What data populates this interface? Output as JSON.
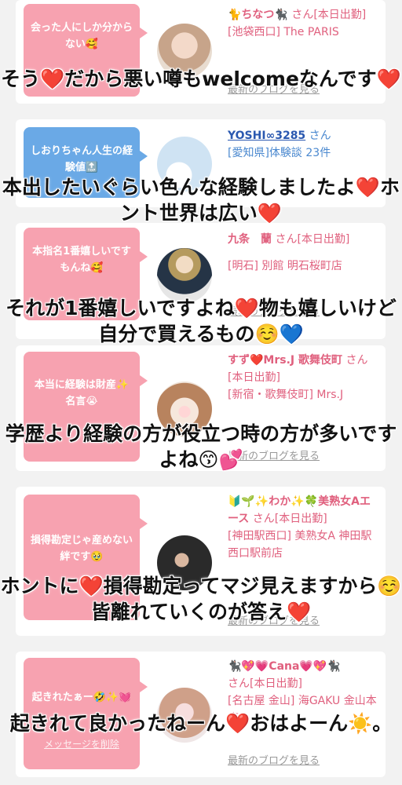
{
  "cards": [
    {
      "message": "会った人にしか分からない🥰",
      "name": "🐈ちなつ🐈‍⬛",
      "san": "さん[本日出勤]",
      "area": "[池袋西口] The PARIS",
      "blog": "最新のブログを見る"
    },
    {
      "message": "しおりちゃん人生の経験値🔝",
      "name": "YOSHI∞3285",
      "san": "さん",
      "area": "[愛知県]体験談 23件"
    },
    {
      "message": "本指名1番嬉しいですもんね🥰",
      "name": "九条　蘭",
      "san": "さん[本日出勤]",
      "area": "[明石] 別館 明石桜町店",
      "blog": "最新のブログを見る"
    },
    {
      "message": "本当に経験は財産✨名言😭",
      "name": "すず❤️Mrs.J 歌舞伎町",
      "san": "さん[本日出勤]",
      "area": "[新宿・歌舞伎町] Mrs.J",
      "blog": "最新のブログを見る"
    },
    {
      "message": "損得勘定じゃ産めない絆です🥹",
      "name": "🔰🌱✨わか✨🍀美熟女Aエース",
      "san": "さん[本日出勤]",
      "area": "[神田駅西口] 美熟女A 神田駅西口駅前店",
      "blog": "最新のブログを見る"
    },
    {
      "message": "起きれたぁー🤣✨💓",
      "delete": "メッセージを削除",
      "name": "🐈‍⬛💖💗Cana💗💖🐈‍⬛",
      "san": "さん[本日出勤]",
      "area": "[名古屋 金山] 海GAKU 金山本店",
      "blog": "最新のブログを見る"
    }
  ],
  "captions": [
    "そう❤️だから悪い噂もwelcomeなんです❤️",
    "本出したいぐらい色んな経験しましたよ❤️ホント世界は広い❤️",
    "それが1番嬉しいですよね❤️物も嬉しいけど自分で買えるもの☺️💙",
    "学歴より経験の方が役立つ時の方が多いですよね😙💕",
    "ホントに❤️損得勘定ってマジ見えますから☺️皆離れていくのが答え❤️",
    "起きれて良かったねーん❤️おはよーん☀️。"
  ],
  "colors": {
    "bubble_pink": "#f7a2b0",
    "bubble_blue": "#6aa9e6",
    "name_pink": "#e0607e",
    "name_blue": "#2a58b0",
    "heart_red": "#d8152c"
  }
}
